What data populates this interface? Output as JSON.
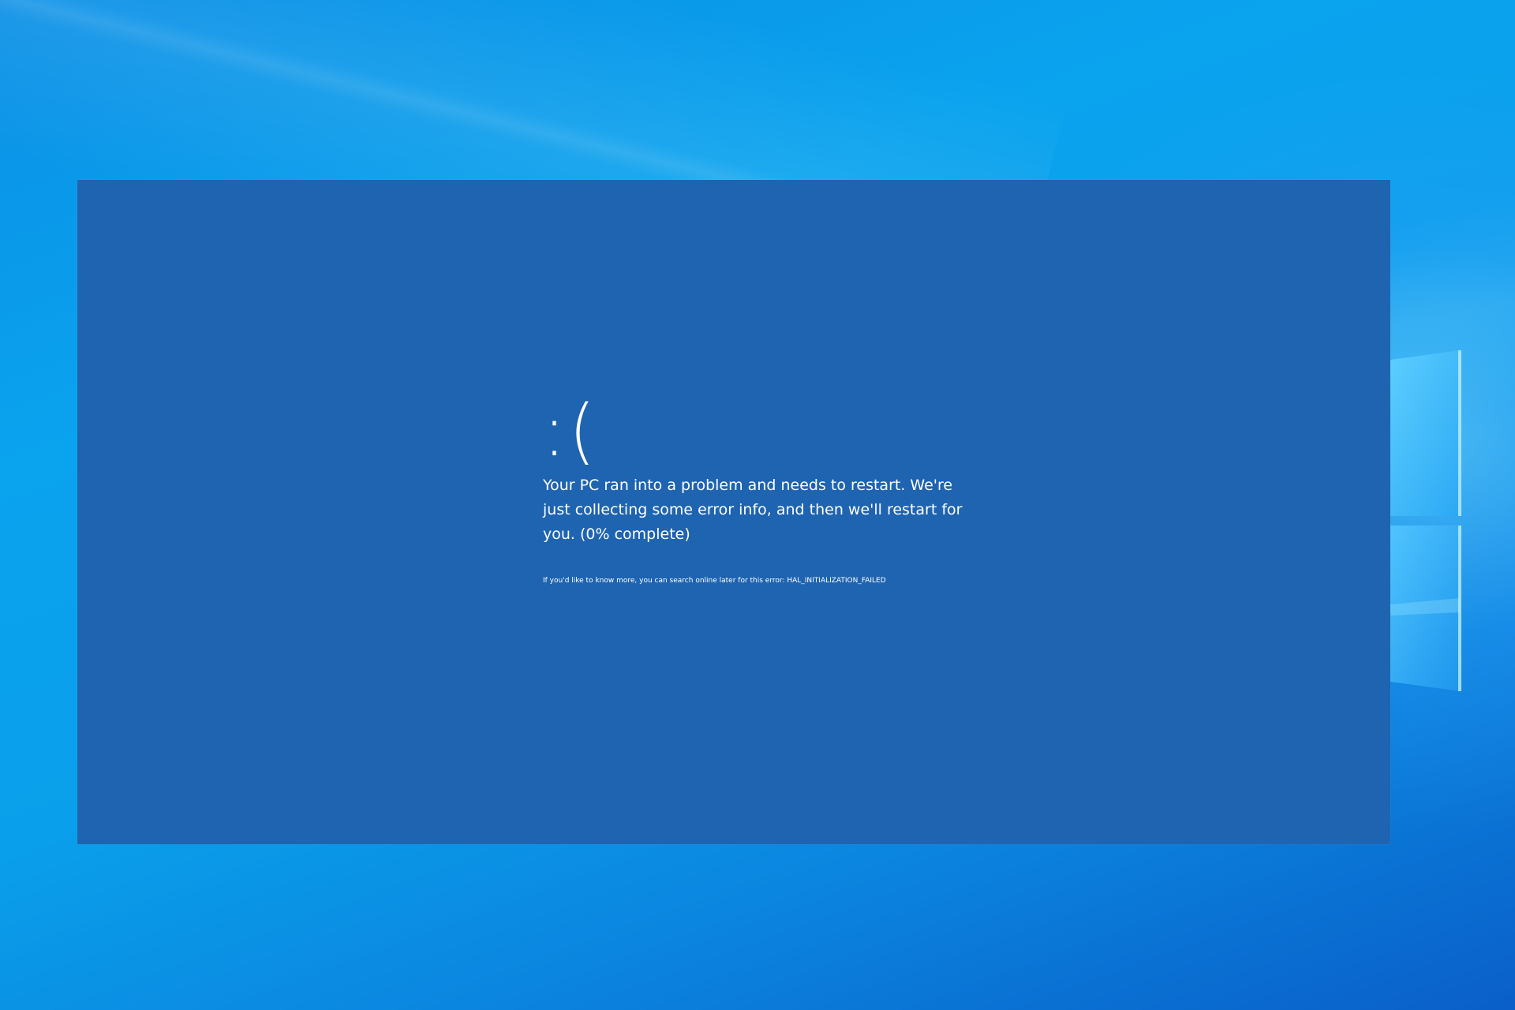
{
  "desktop": {
    "background_color": "#0a9fea",
    "logo_icon": "windows-logo-icon"
  },
  "bsod": {
    "background_color": "#1e64b0",
    "sad_face": ":(",
    "message": "Your PC ran into a problem and needs to restart. We're just collecting some error info, and then we'll restart for you. (0% complete)",
    "progress_percent": 0,
    "info_text": "If you'd like to know more, you can search online later for this error: HAL_INITIALIZATION_FAILED"
  }
}
